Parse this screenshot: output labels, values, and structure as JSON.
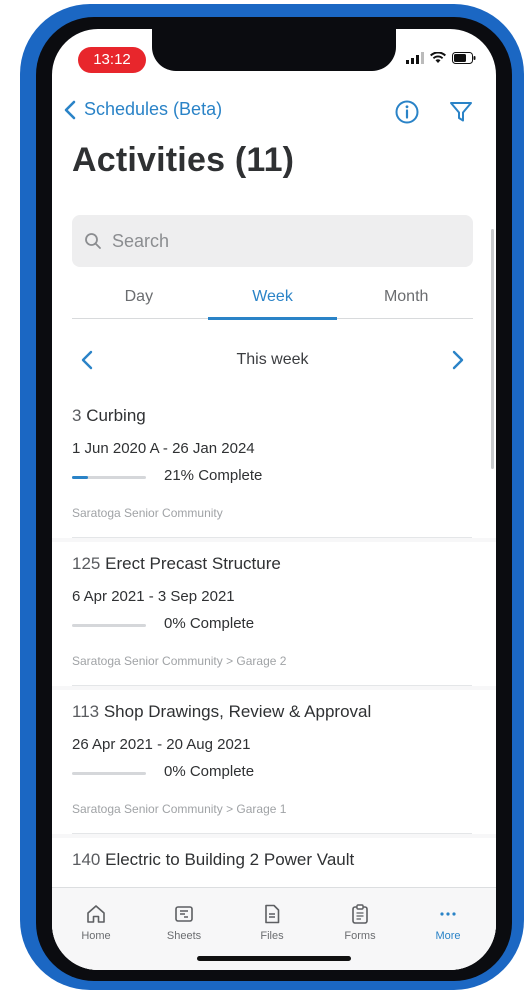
{
  "status_bar": {
    "time": "13:12"
  },
  "nav": {
    "back_label": "Schedules (Beta)"
  },
  "page": {
    "title": "Activities (11)"
  },
  "search": {
    "placeholder": "Search"
  },
  "tabs": [
    {
      "label": "Day",
      "active": false
    },
    {
      "label": "Week",
      "active": true
    },
    {
      "label": "Month",
      "active": false
    }
  ],
  "period": {
    "label": "This week"
  },
  "activities": [
    {
      "number": "3",
      "name": "Curbing",
      "dates": "1 Jun 2020 A - 26 Jan 2024",
      "progress": 0.21,
      "progress_label": "21% Complete",
      "location": "Saratoga Senior Community"
    },
    {
      "number": "125",
      "name": "Erect Precast Structure",
      "dates": "6 Apr 2021 - 3 Sep 2021",
      "progress": 0,
      "progress_label": "0% Complete",
      "location": "Saratoga Senior Community > Garage 2"
    },
    {
      "number": "113",
      "name": "Shop Drawings, Review & Approval",
      "dates": "26 Apr 2021 - 20 Aug 2021",
      "progress": 0,
      "progress_label": "0% Complete",
      "location": "Saratoga Senior Community > Garage 1"
    },
    {
      "number": "140",
      "name": "Electric to Building 2 Power Vault",
      "dates": "",
      "progress": 0,
      "progress_label": "",
      "location": ""
    }
  ],
  "tabbar": [
    {
      "label": "Home",
      "icon": "home-icon"
    },
    {
      "label": "Sheets",
      "icon": "sheets-icon"
    },
    {
      "label": "Files",
      "icon": "files-icon"
    },
    {
      "label": "Forms",
      "icon": "forms-icon"
    },
    {
      "label": "More",
      "icon": "more-icon"
    }
  ],
  "colors": {
    "accent": "#2a83c7",
    "case": "#1b67c3",
    "time_pill": "#e8262c"
  }
}
